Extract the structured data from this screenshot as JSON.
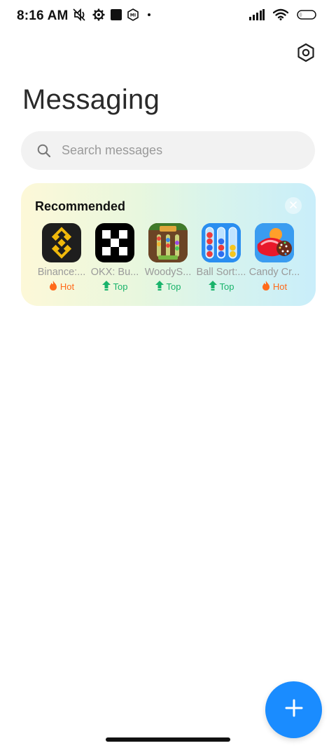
{
  "status_bar": {
    "time": "8:16 AM",
    "left_icons": [
      "mute-icon",
      "settings-small-icon",
      "square-icon",
      "mi-icon",
      "dot-icon"
    ],
    "right_icons": [
      "signal-icon",
      "wifi-icon",
      "battery-icon"
    ]
  },
  "header": {
    "title": "Messaging",
    "settings_icon": "hexagon-settings-icon"
  },
  "search": {
    "placeholder": "Search messages",
    "value": ""
  },
  "recommended": {
    "title": "Recommended",
    "apps": [
      {
        "label": "Binance:...",
        "badge": "Hot",
        "badge_type": "hot"
      },
      {
        "label": "OKX: Bu...",
        "badge": "Top",
        "badge_type": "top"
      },
      {
        "label": "WoodyS...",
        "badge": "Top",
        "badge_type": "top"
      },
      {
        "label": "Ball Sort:...",
        "badge": "Top",
        "badge_type": "top"
      },
      {
        "label": "Candy Cr...",
        "badge": "Hot",
        "badge_type": "hot"
      }
    ]
  },
  "colors": {
    "accent": "#1a8cff",
    "hot": "#ff6a1a",
    "top": "#19b36b"
  },
  "fab": {
    "icon": "plus-icon"
  }
}
